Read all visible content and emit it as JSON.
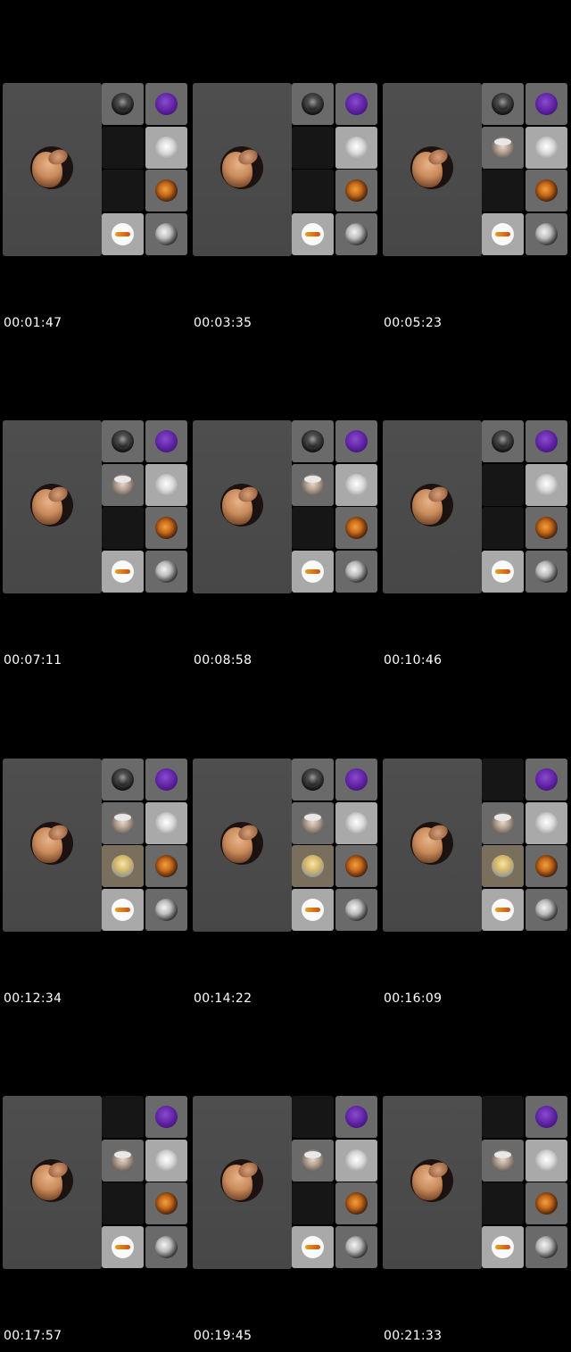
{
  "frames": [
    {
      "timestamp": "00:01:47",
      "tiles": [
        "beard",
        "purple",
        "empty",
        "white",
        "empty",
        "fire",
        "logo",
        "sketch"
      ]
    },
    {
      "timestamp": "00:03:35",
      "tiles": [
        "beard",
        "purple",
        "empty",
        "white",
        "empty",
        "fire",
        "logo",
        "sketch"
      ]
    },
    {
      "timestamp": "00:05:23",
      "tiles": [
        "beard",
        "purple",
        "grandpa",
        "white",
        "empty",
        "fire",
        "logo",
        "sketch"
      ]
    },
    {
      "timestamp": "00:07:11",
      "tiles": [
        "beard",
        "purple",
        "grandpa",
        "white",
        "empty",
        "fire",
        "logo",
        "sketch"
      ]
    },
    {
      "timestamp": "00:08:58",
      "tiles": [
        "beard",
        "purple",
        "grandpa",
        "white",
        "empty",
        "fire",
        "logo",
        "sketch"
      ]
    },
    {
      "timestamp": "00:10:46",
      "tiles": [
        "beard",
        "purple",
        "empty",
        "white",
        "empty",
        "fire",
        "logo",
        "sketch"
      ]
    },
    {
      "timestamp": "00:12:34",
      "tiles": [
        "beard",
        "purple",
        "grandpa",
        "white",
        "sun",
        "fire",
        "logo",
        "sketch"
      ]
    },
    {
      "timestamp": "00:14:22",
      "tiles": [
        "beard",
        "purple",
        "grandpa",
        "white",
        "sun",
        "fire",
        "logo",
        "sketch"
      ]
    },
    {
      "timestamp": "00:16:09",
      "tiles": [
        "empty",
        "purple",
        "grandpa",
        "white",
        "sun",
        "fire",
        "logo",
        "sketch"
      ]
    },
    {
      "timestamp": "00:17:57",
      "tiles": [
        "empty",
        "purple",
        "grandpa",
        "white",
        "empty",
        "fire",
        "logo",
        "sketch"
      ]
    },
    {
      "timestamp": "00:19:45",
      "tiles": [
        "empty",
        "purple",
        "grandpa",
        "white",
        "empty",
        "fire",
        "logo",
        "sketch"
      ]
    },
    {
      "timestamp": "00:21:33",
      "tiles": [
        "empty",
        "purple",
        "grandpa",
        "white",
        "empty",
        "fire",
        "logo",
        "sketch"
      ]
    }
  ],
  "icons": {
    "main": "woman-portrait-avatar",
    "beard": "bearded-man-avatar",
    "purple": "purple-moon-avatar",
    "white": "white-creature-avatar",
    "fire": "fire-figure-avatar",
    "logo": "orange-logo-avatar",
    "sketch": "sketch-portrait-avatar",
    "grandpa": "old-man-avatar",
    "sun": "sunny-figure-avatar"
  },
  "colors": {
    "background": "#000000",
    "main_tile": "#4a4a4a",
    "tile": "#555555",
    "empty_tile": "#161616",
    "timestamp_text": "#ffffff"
  }
}
